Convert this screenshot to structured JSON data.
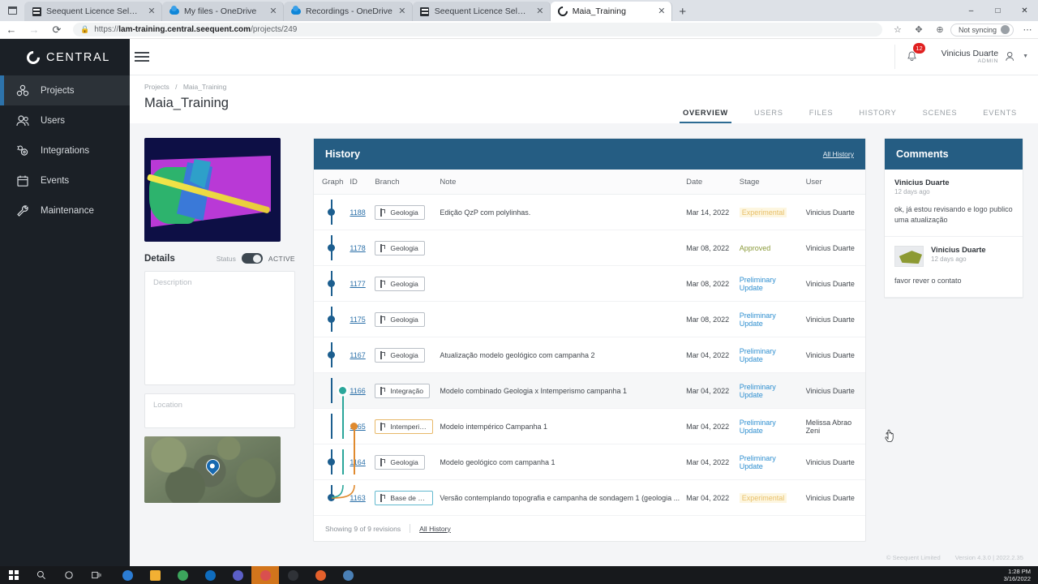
{
  "browser": {
    "tabs": [
      {
        "label": "Seequent Licence Selection",
        "icon": "seequent-icon",
        "active": false
      },
      {
        "label": "My files - OneDrive",
        "icon": "onedrive-icon",
        "active": false
      },
      {
        "label": "Recordings - OneDrive",
        "icon": "onedrive-icon",
        "active": false
      },
      {
        "label": "Seequent Licence Selection",
        "icon": "seequent-icon",
        "active": false
      },
      {
        "label": "Maia_Training",
        "icon": "central-icon",
        "active": true
      }
    ],
    "new_tab_label": "+",
    "window_controls": [
      "–",
      "□",
      "✕"
    ],
    "back_label": "←",
    "forward_label": "→",
    "reload_label": "⟳",
    "lock_label": "ὑ2",
    "url_prefix": "https://",
    "url_host": "lam-training.central.seequent.com",
    "url_path": "/projects/249",
    "favorite_label": "☆",
    "collections_label": "✥",
    "extensions_label": "⊕",
    "sync_label": "Not syncing",
    "more_label": "⋯"
  },
  "sidebar": {
    "brand": "CENTRAL",
    "items": [
      {
        "label": "Projects",
        "icon": "projects-icon",
        "active": true
      },
      {
        "label": "Users",
        "icon": "users-icon",
        "active": false
      },
      {
        "label": "Integrations",
        "icon": "integrations-icon",
        "active": false
      },
      {
        "label": "Events",
        "icon": "calendar-icon",
        "active": false
      },
      {
        "label": "Maintenance",
        "icon": "wrench-icon",
        "active": false
      }
    ]
  },
  "topbar": {
    "notification_count": "12",
    "user_name": "Vinicius Duarte",
    "user_role": "ADMIN"
  },
  "page": {
    "breadcrumb_root": "Projects",
    "breadcrumb_sep": "/",
    "breadcrumb_current": "Maia_Training",
    "title": "Maia_Training",
    "tabs": [
      {
        "label": "OVERVIEW",
        "active": true
      },
      {
        "label": "USERS",
        "active": false
      },
      {
        "label": "FILES",
        "active": false
      },
      {
        "label": "HISTORY",
        "active": false
      },
      {
        "label": "SCENES",
        "active": false
      },
      {
        "label": "EVENTS",
        "active": false
      }
    ]
  },
  "details": {
    "title": "Details",
    "status_label": "Status",
    "status_value": "ACTIVE",
    "description_placeholder": "Description",
    "location_placeholder": "Location"
  },
  "history": {
    "title": "History",
    "all_history_link": "All History",
    "columns": [
      "Graph",
      "ID",
      "Branch",
      "Note",
      "Date",
      "Stage",
      "User"
    ],
    "rows": [
      {
        "id": "1188",
        "branch": "Geologia",
        "note": "Edição QzP com polylinhas.",
        "date": "Mar 14, 2022",
        "stage": "Experimental",
        "stage_kind": "exp",
        "user": "Vinicius Duarte",
        "graph": "main",
        "branch_color": "gray"
      },
      {
        "id": "1178",
        "branch": "Geologia",
        "note": "",
        "date": "Mar 08, 2022",
        "stage": "Approved",
        "stage_kind": "approved",
        "user": "Vinicius Duarte",
        "graph": "main",
        "branch_color": "gray"
      },
      {
        "id": "1177",
        "branch": "Geologia",
        "note": "",
        "date": "Mar 08, 2022",
        "stage": "Preliminary Update",
        "stage_kind": "prelim",
        "user": "Vinicius Duarte",
        "graph": "main",
        "branch_color": "gray"
      },
      {
        "id": "1175",
        "branch": "Geologia",
        "note": "",
        "date": "Mar 08, 2022",
        "stage": "Preliminary Update",
        "stage_kind": "prelim",
        "user": "Vinicius Duarte",
        "graph": "main",
        "branch_color": "gray"
      },
      {
        "id": "1167",
        "branch": "Geologia",
        "note": "Atualização modelo geológico com campanha 2",
        "date": "Mar 04, 2022",
        "stage": "Preliminary Update",
        "stage_kind": "prelim",
        "user": "Vinicius Duarte",
        "graph": "main",
        "branch_color": "gray"
      },
      {
        "id": "1166",
        "branch": "Integração",
        "note": "Modelo combinado Geologia x Intemperismo campanha 1",
        "date": "Mar 04, 2022",
        "stage": "Preliminary Update",
        "stage_kind": "prelim",
        "user": "Vinicius Duarte",
        "graph": "teal",
        "branch_color": "gray",
        "highlight": true
      },
      {
        "id": "1165",
        "branch": "Intemperis...",
        "note": "Modelo intempérico Campanha 1",
        "date": "Mar 04, 2022",
        "stage": "Preliminary Update",
        "stage_kind": "prelim",
        "user": "Melissa Abrao Zeni",
        "graph": "orange",
        "branch_color": "orange"
      },
      {
        "id": "1164",
        "branch": "Geologia",
        "note": "Modelo geológico com campanha 1",
        "date": "Mar 04, 2022",
        "stage": "Preliminary Update",
        "stage_kind": "prelim",
        "user": "Vinicius Duarte",
        "graph": "main",
        "branch_color": "gray"
      },
      {
        "id": "1163",
        "branch": "Base de da...",
        "note": "Versão contemplando topografia e campanha de sondagem 1 (geologia ...",
        "date": "Mar 04, 2022",
        "stage": "Experimental",
        "stage_kind": "exp",
        "user": "Vinicius Duarte",
        "graph": "merge",
        "branch_color": "blue"
      }
    ],
    "footer_count": "Showing 9 of 9 revisions",
    "footer_link": "All History"
  },
  "comments": {
    "title": "Comments",
    "items": [
      {
        "author": "Vinicius Duarte",
        "time": "12 days ago",
        "text": "ok, já estou revisando e logo publico uma atualização",
        "has_thumb": false
      },
      {
        "author": "Vinicius Duarte",
        "time": "12 days ago",
        "text": "favor rever o contato",
        "has_thumb": true
      }
    ]
  },
  "footer": {
    "copyright": "© Seequent Limited",
    "version": "Version 4.3.0 | 2022.2.35"
  },
  "taskbar": {
    "start_label": "start-icon",
    "search_label": "search-icon",
    "cortana_label": "cortana-icon",
    "taskview_label": "task-view-icon",
    "apps": [
      {
        "name": "edge-icon",
        "color": "#2b7cd3"
      },
      {
        "name": "file-explorer-icon",
        "color": "#f2b033"
      },
      {
        "name": "chrome-icon",
        "color": "#3ca55c"
      },
      {
        "name": "outlook-icon",
        "color": "#0f6cbd"
      },
      {
        "name": "teams-icon",
        "color": "#5b5fc7"
      },
      {
        "name": "leapfrog-icon",
        "color": "#d94f4f"
      },
      {
        "name": "app-dark-icon",
        "color": "#2f3237"
      },
      {
        "name": "app-orange-icon",
        "color": "#e4602b"
      },
      {
        "name": "app-blue-icon",
        "color": "#4a7fb5"
      }
    ],
    "time": "1:28 PM",
    "date": "3/16/2022"
  },
  "colors": {
    "brand_dark": "#1b2026",
    "accent_blue": "#255d83",
    "link_blue": "#2a6fa8",
    "stage_prelim": "#2f8fd0",
    "stage_approved": "#8a9a3a",
    "stage_experimental": "#e8c06a"
  }
}
